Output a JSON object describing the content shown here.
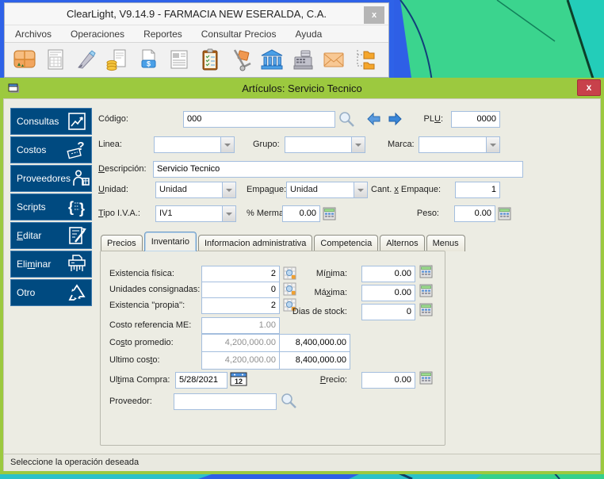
{
  "app_window": {
    "title": "ClearLight, V9.14.9 - FARMACIA NEW ESERALDA, C.A.",
    "close_label": "x",
    "menu": [
      {
        "label": "Archivos"
      },
      {
        "label": "Operaciones"
      },
      {
        "label": "Reportes"
      },
      {
        "label": "Consultar Precios"
      },
      {
        "label": "Ayuda"
      }
    ],
    "toolbar_icons": [
      "picture",
      "spreadsheet-document",
      "pen",
      "coins-document",
      "price-document",
      "newspaper",
      "checklist-clipboard",
      "hand-truck",
      "bank",
      "cash-register",
      "envelope",
      "folder-tree"
    ]
  },
  "dialog": {
    "title": "Artículos: Servicio Tecnico",
    "close_label": "x",
    "sidebar": [
      {
        "label": {
          "pre": "Consultas",
          "accel": "",
          "post": ""
        },
        "icon": "chart"
      },
      {
        "label": {
          "pre": "Costos",
          "accel": "",
          "post": ""
        },
        "icon": "ticket-question"
      },
      {
        "label": {
          "pre": "Proveedores",
          "accel": "",
          "post": ""
        },
        "icon": "person-box"
      },
      {
        "label": {
          "pre": "Scripts",
          "accel": "",
          "post": ""
        },
        "icon": "braces"
      },
      {
        "label": {
          "pre": "",
          "accel": "E",
          "post": "ditar"
        },
        "icon": "edit-document"
      },
      {
        "label": {
          "pre": "Eli",
          "accel": "m",
          "post": "inar"
        },
        "icon": "shredder"
      },
      {
        "label": {
          "pre": "Otro",
          "accel": "",
          "post": ""
        },
        "icon": "recycle"
      }
    ],
    "header": {
      "labels": {
        "codigo": {
          "pre": "Código:",
          "accel": "",
          "post": ""
        },
        "plu": {
          "pre": "PL",
          "accel": "U",
          "post": ":"
        },
        "linea": {
          "pre": "Linea:",
          "accel": "",
          "post": ""
        },
        "grupo": {
          "pre": "Grupo:",
          "accel": "",
          "post": ""
        },
        "marca": {
          "pre": "Marca:",
          "accel": "",
          "post": ""
        },
        "descripcion": {
          "pre": "",
          "accel": "D",
          "post": "escripción:"
        },
        "unidad": {
          "pre": "",
          "accel": "U",
          "post": "nidad:"
        },
        "empaque": {
          "pre": "Empa",
          "accel": "q",
          "post": "ue:"
        },
        "cant_empaque": {
          "pre": "Cant. ",
          "accel": "x",
          "post": " Empaque:"
        },
        "tipo_iva": {
          "pre": "",
          "accel": "T",
          "post": "ipo I.V.A.:"
        },
        "merma": {
          "pre": "% Merma:",
          "accel": "",
          "post": ""
        },
        "peso": {
          "pre": "Peso:",
          "accel": "",
          "post": ""
        }
      },
      "values": {
        "codigo": "000",
        "plu": "0000",
        "linea": "",
        "grupo": "",
        "marca": "",
        "descripcion": "Servicio Tecnico",
        "unidad": "Unidad",
        "empaque": "Unidad",
        "cant_empaque": "1",
        "tipo_iva": "IV1",
        "merma": "0.00",
        "peso": "0.00"
      }
    },
    "tabs": [
      {
        "label": "Precios",
        "active": false
      },
      {
        "label": "Inventario",
        "active": true
      },
      {
        "label": "Informacion administrativa",
        "active": false
      },
      {
        "label": "Competencia",
        "active": false
      },
      {
        "label": "Alternos",
        "active": false
      },
      {
        "label": "Menus",
        "active": false
      }
    ],
    "inventory": {
      "labels": {
        "existencia_fisica": {
          "pre": "Existencia física:",
          "accel": "",
          "post": ""
        },
        "unidades_consignadas": {
          "pre": "Unidades consignadas:",
          "accel": "",
          "post": ""
        },
        "existencia_propia": {
          "pre": "Existencia ''propia'':",
          "accel": "",
          "post": ""
        },
        "costo_referencia": {
          "pre": "Costo referencia ME:",
          "accel": "",
          "post": ""
        },
        "costo_promedio": {
          "pre": "Co",
          "accel": "s",
          "post": "to promedio:"
        },
        "ultimo_costo": {
          "pre": "Ultimo cos",
          "accel": "t",
          "post": "o:"
        },
        "minima": {
          "pre": "Mí",
          "accel": "n",
          "post": "ima:"
        },
        "maxima": {
          "pre": "Má",
          "accel": "x",
          "post": "ima:"
        },
        "dias_stock": {
          "pre": "Dias de stock:",
          "accel": "",
          "post": ""
        },
        "ultima_compra": {
          "pre": "Ul",
          "accel": "t",
          "post": "ima Compra:"
        },
        "precio": {
          "pre": "",
          "accel": "P",
          "post": "recio:"
        },
        "proveedor": {
          "pre": "Proveedor:",
          "accel": "",
          "post": ""
        }
      },
      "values": {
        "existencia_fisica": "2",
        "unidades_consignadas": "0",
        "existencia_propia": "2",
        "costo_referencia": "1.00",
        "costo_promedio_me": "4,200,000.00",
        "costo_promedio_local": "8,400,000.00",
        "ultimo_costo_me": "4,200,000.00",
        "ultimo_costo_local": "8,400,000.00",
        "minima": "0.00",
        "maxima": "0.00",
        "dias_stock": "0",
        "ultima_compra": "5/28/2021",
        "precio": "0.00",
        "proveedor": ""
      },
      "calendar_icon_number": "12"
    },
    "status_bar": "Seleccione la operación deseada"
  },
  "colors": {
    "dialog_green": "#9cc93f",
    "sidebar_navy": "#004a80",
    "close_red": "#c8414b",
    "desktop_blue": "#2e5fe6",
    "desktop_green": "#3bd48e",
    "desktop_teal": "#2bc1c9",
    "field_border": "#a4bede"
  }
}
